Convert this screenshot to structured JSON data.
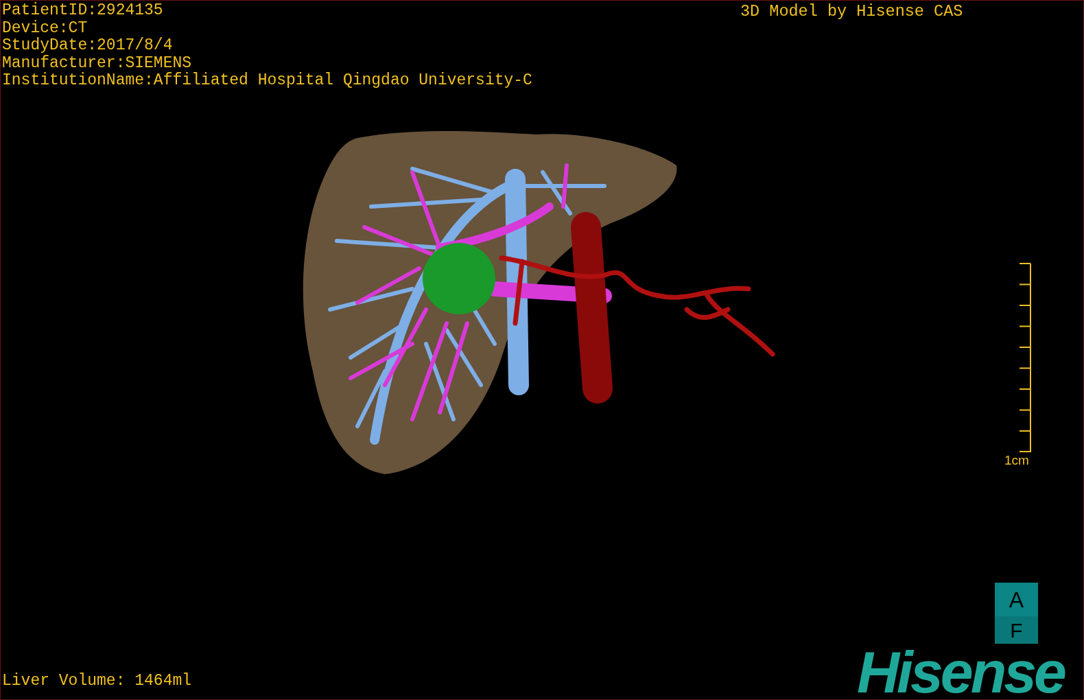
{
  "study_info": [
    "PatientID:2924135",
    "Device:CT",
    "StudyDate:2017/8/4",
    "Manufacturer:SIEMENS",
    "InstitutionName:Affiliated Hospital Qingdao University-C"
  ],
  "header": "3D Model by Hisense CAS",
  "scale_bar": {
    "label": "1cm"
  },
  "orientation_cube": {
    "top": "A",
    "bottom": "F"
  },
  "logo": "Hisense",
  "liver_volume": "Liver Volume: 1464ml"
}
